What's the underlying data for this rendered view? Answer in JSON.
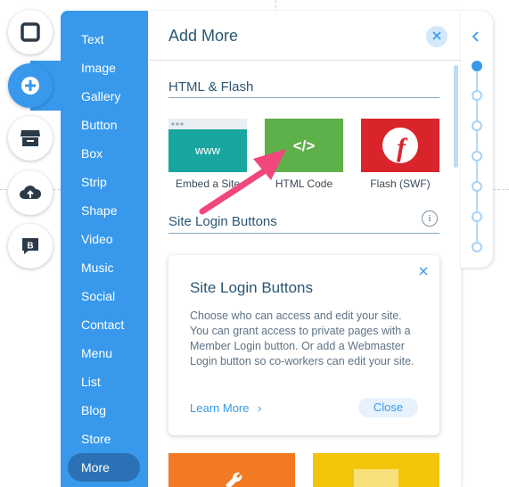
{
  "tools": [
    {
      "name": "background-tool",
      "icon": "square-icon"
    },
    {
      "name": "add-tool",
      "icon": "plus-icon",
      "active": true
    },
    {
      "name": "store-tool",
      "icon": "store-icon"
    },
    {
      "name": "upload-tool",
      "icon": "cloud-upload-icon"
    },
    {
      "name": "blog-tool",
      "icon": "blog-b-icon",
      "glyph": "B"
    }
  ],
  "categories": [
    "Text",
    "Image",
    "Gallery",
    "Button",
    "Box",
    "Strip",
    "Shape",
    "Video",
    "Music",
    "Social",
    "Contact",
    "Menu",
    "List",
    "Blog",
    "Store",
    "More"
  ],
  "selected_category": "More",
  "panel": {
    "title": "Add More",
    "section_html": "HTML & Flash",
    "tiles": [
      {
        "label": "Embed a Site",
        "glyph": "www",
        "color": "#1aa6a0"
      },
      {
        "label": "HTML Code",
        "glyph": "</>",
        "color": "#5eb04a"
      },
      {
        "label": "Flash (SWF)",
        "glyph": "f",
        "color": "#d9242b"
      }
    ],
    "section_login": "Site Login Buttons",
    "info_glyph": "i",
    "card": {
      "title": "Site Login Buttons",
      "body": "Choose who can access and edit your site. You can grant access to private pages with a Member Login button. Or add a Webmaster Login button so co-workers can edit your site.",
      "learn_more": "Learn More",
      "chevron": "›",
      "close": "Close"
    },
    "bottom_tiles": [
      {
        "color": "#f27a22"
      },
      {
        "color": "#f2c50a"
      }
    ]
  },
  "navigator": {
    "active_index": 0,
    "dots": 7
  },
  "colors": {
    "accent": "#3899ec",
    "title": "#2b5672",
    "arrow": "#f0487c"
  }
}
